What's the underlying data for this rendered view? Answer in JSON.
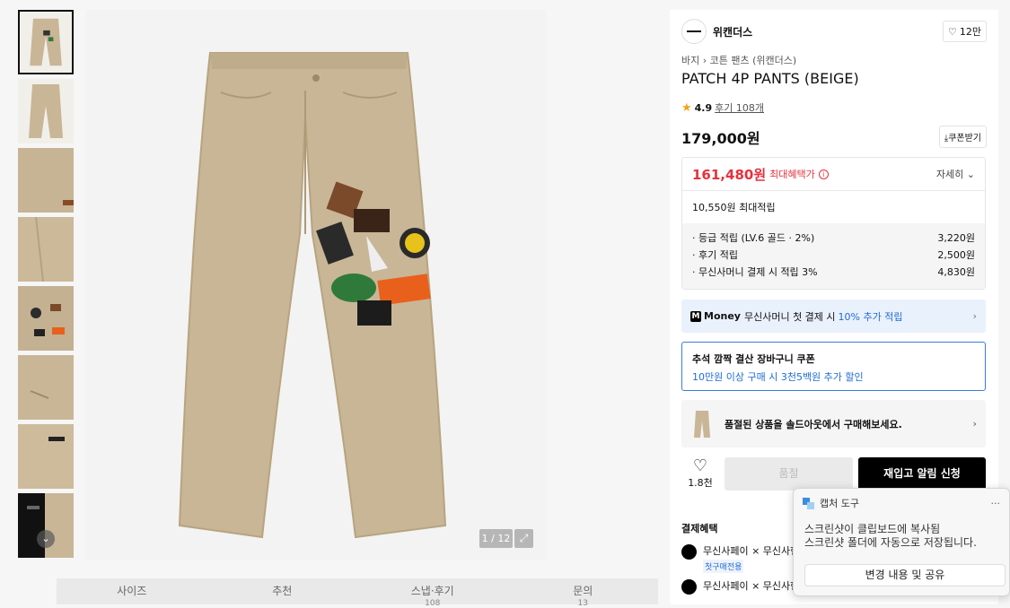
{
  "gallery": {
    "counter": "1 / 12",
    "thumb_count": 8
  },
  "tabs": [
    {
      "label": "사이즈",
      "count": ""
    },
    {
      "label": "추천",
      "count": ""
    },
    {
      "label": "스냅·후기",
      "count": "108"
    },
    {
      "label": "문의",
      "count": "13"
    }
  ],
  "product": {
    "brand": "위캔더스",
    "likes": "12만",
    "breadcrumb_1": "바지",
    "breadcrumb_2": "코튼 팬츠 (위캔더스)",
    "title": "PATCH 4P PANTS (BEIGE)",
    "rating": "4.9",
    "reviews": "후기 108개",
    "price": "179,000원",
    "coupon": "쿠폰받기"
  },
  "benefit": {
    "sale_price": "161,480원",
    "sale_label": "최대혜택가",
    "detail": "자세히",
    "points_total": "10,550원 최대적립",
    "points": [
      {
        "label": "· 등급 적립 (LV.6 골드 · 2%)",
        "value": "3,220원"
      },
      {
        "label": "· 후기 적립",
        "value": "2,500원"
      },
      {
        "label": "· 무신사머니 결제 시 적립 3%",
        "value": "4,830원"
      }
    ]
  },
  "money": {
    "brand": "Money",
    "text": "무신사머니 첫 결제 시",
    "highlight": "10% 추가 적립"
  },
  "chuseok": {
    "title": "추석 깜짝 결산 장바구니 쿠폰",
    "subtitle": "10만원 이상 구매 시 3천5백원 추가 할인"
  },
  "soldout_banner": "품절된 상품을 솔드아웃에서 구매해보세요.",
  "actions": {
    "wish_count": "1.8천",
    "soldout": "품절",
    "restock": "재입고 알림 신청"
  },
  "payment": {
    "title": "결제혜택",
    "items": [
      {
        "label": "무신사페이 × 무신사현",
        "badge": "첫구매전용"
      },
      {
        "label": "무신사페이 × 무신사현",
        "badge": ""
      }
    ]
  },
  "toast": {
    "app": "캡처 도구",
    "line1": "스크린샷이 클립보드에 복사됨",
    "line2": "스크린샷 폴더에 자동으로 저장됩니다.",
    "button": "변경 내용 및 공유"
  },
  "colors": {
    "sale": "#e8313b",
    "accent_blue": "#1f6bd8",
    "khaki": "#c9b697"
  }
}
